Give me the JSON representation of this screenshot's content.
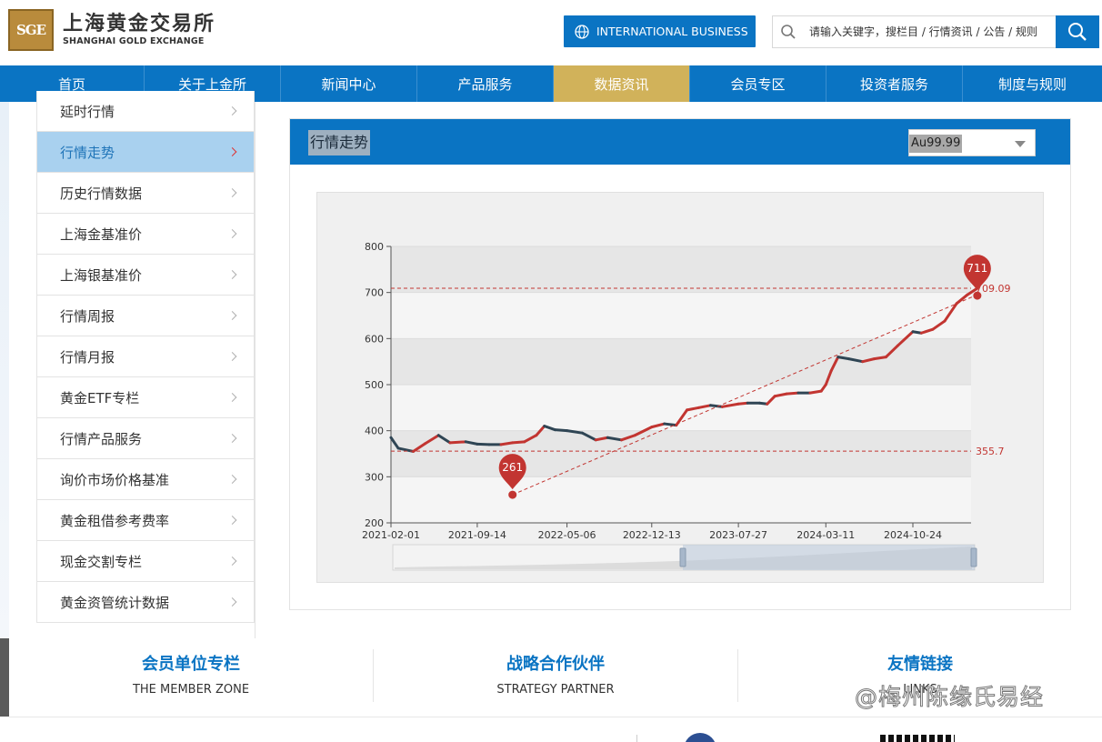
{
  "header": {
    "logo_mark": "SGE",
    "logo_cn": "上海黄金交易所",
    "logo_en": "SHANGHAI GOLD EXCHANGE",
    "intl_button": "INTERNATIONAL BUSINESS",
    "search_placeholder": "请输入关键字，搜栏目 / 行情资讯 / 公告 / 规则"
  },
  "nav": {
    "items": [
      {
        "label": "首页"
      },
      {
        "label": "关于上金所"
      },
      {
        "label": "新闻中心"
      },
      {
        "label": "产品服务"
      },
      {
        "label": "数据资讯",
        "active": true
      },
      {
        "label": "会员专区"
      },
      {
        "label": "投资者服务"
      },
      {
        "label": "制度与规则"
      }
    ]
  },
  "sidebar": {
    "items": [
      {
        "label": "延时行情"
      },
      {
        "label": "行情走势",
        "active": true
      },
      {
        "label": "历史行情数据"
      },
      {
        "label": "上海金基准价"
      },
      {
        "label": "上海银基准价"
      },
      {
        "label": "行情周报"
      },
      {
        "label": "行情月报"
      },
      {
        "label": "黄金ETF专栏"
      },
      {
        "label": "行情产品服务"
      },
      {
        "label": "询价市场价格基准"
      },
      {
        "label": "黄金租借参考费率"
      },
      {
        "label": "现金交割专栏"
      },
      {
        "label": "黄金资管统计数据"
      }
    ]
  },
  "panel": {
    "title": "行情走势",
    "selected_product": "Au99.99"
  },
  "chart_data": {
    "type": "line",
    "title": "",
    "xlabel": "",
    "ylabel": "",
    "x_ticks": [
      "2021-02-01",
      "2021-09-14",
      "2022-05-06",
      "2022-12-13",
      "2023-07-27",
      "2024-03-11",
      "2024-10-24"
    ],
    "y_ticks": [
      200,
      300,
      400,
      500,
      600,
      700,
      800
    ],
    "ylim": [
      200,
      800
    ],
    "grid": true,
    "series": [
      {
        "values": [
          [
            "2021-02-01",
            385
          ],
          [
            "2021-02-20",
            362
          ],
          [
            "2021-03-31",
            355
          ],
          [
            "2021-05-01",
            372
          ],
          [
            "2021-06-05",
            390
          ],
          [
            "2021-07-05",
            374
          ],
          [
            "2021-08-15",
            376
          ],
          [
            "2021-09-14",
            371
          ],
          [
            "2021-10-15",
            370
          ],
          [
            "2021-11-15",
            370
          ],
          [
            "2021-12-15",
            374
          ],
          [
            "2022-01-15",
            376
          ],
          [
            "2022-02-15",
            390
          ],
          [
            "2022-03-08",
            410
          ],
          [
            "2022-04-05",
            402
          ],
          [
            "2022-05-06",
            400
          ],
          [
            "2022-06-15",
            395
          ],
          [
            "2022-07-20",
            380
          ],
          [
            "2022-08-20",
            385
          ],
          [
            "2022-09-25",
            380
          ],
          [
            "2022-10-30",
            390
          ],
          [
            "2022-12-13",
            408
          ],
          [
            "2023-01-15",
            415
          ],
          [
            "2023-02-15",
            412
          ],
          [
            "2023-03-15",
            445
          ],
          [
            "2023-04-15",
            450
          ],
          [
            "2023-05-15",
            455
          ],
          [
            "2023-06-15",
            452
          ],
          [
            "2023-07-27",
            458
          ],
          [
            "2023-08-20",
            460
          ],
          [
            "2023-09-20",
            460
          ],
          [
            "2023-10-10",
            458
          ],
          [
            "2023-10-30",
            475
          ],
          [
            "2023-11-30",
            480
          ],
          [
            "2023-12-30",
            482
          ],
          [
            "2024-01-30",
            482
          ],
          [
            "2024-02-28",
            486
          ],
          [
            "2024-03-11",
            500
          ],
          [
            "2024-03-25",
            530
          ],
          [
            "2024-04-12",
            560
          ],
          [
            "2024-05-10",
            556
          ],
          [
            "2024-06-15",
            550
          ],
          [
            "2024-07-15",
            556
          ],
          [
            "2024-08-15",
            560
          ],
          [
            "2024-09-15",
            585
          ],
          [
            "2024-10-24",
            615
          ],
          [
            "2024-11-15",
            612
          ],
          [
            "2024-12-15",
            620
          ],
          [
            "2025-01-15",
            638
          ],
          [
            "2025-02-15",
            676
          ],
          [
            "2025-03-15",
            695
          ],
          [
            "2025-04-10",
            709.09
          ]
        ]
      }
    ],
    "annotations": [
      {
        "type": "max",
        "label": "711",
        "x": "2025-04-10",
        "y": 711
      },
      {
        "type": "min",
        "label": "261",
        "x": "2021-12-15",
        "y": 261
      },
      {
        "type": "hline",
        "label": "709.09",
        "y": 709.09
      },
      {
        "type": "hline",
        "label": "355.7",
        "y": 355.7
      }
    ]
  },
  "footer": {
    "columns": [
      {
        "cn": "会员单位专栏",
        "en": "THE MEMBER ZONE"
      },
      {
        "cn": "战略合作伙伴",
        "en": "STRATEGY PARTNER"
      },
      {
        "cn": "友情链接",
        "en": "LINKS"
      }
    ],
    "watermark": "@梅州陈缘氏易经"
  },
  "colors": {
    "brand_blue": "#0a74c3",
    "nav_active": "#d1b25a",
    "candle_up": "#c23531",
    "candle_down": "#2f4554",
    "marker_red": "#c23531"
  }
}
